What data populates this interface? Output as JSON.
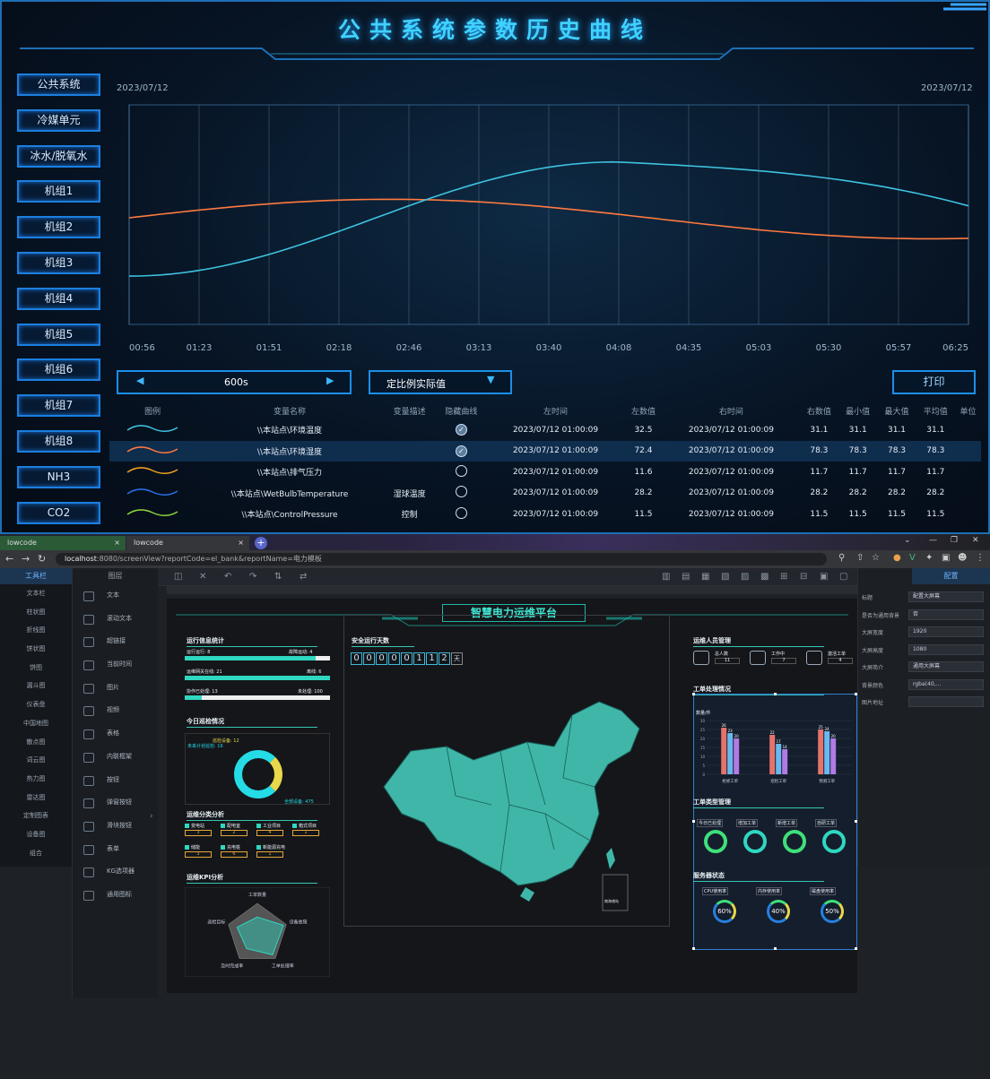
{
  "top": {
    "title": "公共系统参数历史曲线",
    "date_left": "2023/07/12",
    "date_right": "2023/07/12",
    "side_buttons": [
      "公共系统",
      "冷媒单元",
      "冰水/脱氧水",
      "机组1",
      "机组2",
      "机组3",
      "机组4",
      "机组5",
      "机组6",
      "机组7",
      "机组8",
      "NH3",
      "CO2"
    ],
    "time_ticks": [
      "00:56",
      "01:23",
      "01:51",
      "02:18",
      "02:46",
      "03:13",
      "03:40",
      "04:08",
      "04:35",
      "05:03",
      "05:30",
      "05:57",
      "06:25"
    ],
    "interval": "600s",
    "scale_mode": "定比例实际值",
    "print": "打印",
    "columns": [
      "图例",
      "变量名称",
      "变量描述",
      "隐藏曲线",
      "左时间",
      "左数值",
      "右时间",
      "右数值",
      "最小值",
      "最大值",
      "平均值",
      "单位"
    ],
    "rows": [
      {
        "color": "#3ec3e0",
        "name": "\\\\本站点\\环境温度",
        "desc": "",
        "hidden": true,
        "lt": "2023/07/12 01:00:09",
        "lv": "32.5",
        "rt": "2023/07/12 01:00:09",
        "rv": "31.1",
        "min": "31.1",
        "max": "31.1",
        "avg": "31.1",
        "unit": ""
      },
      {
        "color": "#ff7a40",
        "name": "\\\\本站点\\环境湿度",
        "desc": "",
        "hidden": true,
        "lt": "2023/07/12 01:00:09",
        "lv": "72.4",
        "rt": "2023/07/12 01:00:09",
        "rv": "78.3",
        "min": "78.3",
        "max": "78.3",
        "avg": "78.3",
        "unit": ""
      },
      {
        "color": "#f0a020",
        "name": "\\\\本站点\\排气压力",
        "desc": "",
        "hidden": false,
        "lt": "2023/07/12 01:00:09",
        "lv": "11.6",
        "rt": "2023/07/12 01:00:09",
        "rv": "11.7",
        "min": "11.7",
        "max": "11.7",
        "avg": "11.7",
        "unit": ""
      },
      {
        "color": "#2a6fe8",
        "name": "\\\\本站点\\WetBulbTemperature",
        "desc": "湿球温度",
        "hidden": false,
        "lt": "2023/07/12 01:00:09",
        "lv": "28.2",
        "rt": "2023/07/12 01:00:09",
        "rv": "28.2",
        "min": "28.2",
        "max": "28.2",
        "avg": "28.2",
        "unit": ""
      },
      {
        "color": "#8ad23a",
        "name": "\\\\本站点\\ControlPressure",
        "desc": "控制",
        "hidden": false,
        "lt": "2023/07/12 01:00:09",
        "lv": "11.5",
        "rt": "2023/07/12 01:00:09",
        "rv": "11.5",
        "min": "11.5",
        "max": "11.5",
        "avg": "11.5",
        "unit": ""
      }
    ],
    "curve_colors": {
      "teal": "#3ec3e0",
      "orange": "#ff7a40"
    }
  },
  "browser": {
    "tab1": "lowcode",
    "tab2": "lowcode",
    "url_host": "localhost",
    "url_rest": ":8080/screenView?reportCode=el_bank&reportName=电力模板"
  },
  "app": {
    "left_head": "工具栏",
    "left_items": [
      "文本栏",
      "柱状图",
      "折线图",
      "饼状图",
      "饼图",
      "漏斗图",
      "仪表盘",
      "中国地图",
      "散点图",
      "词云图",
      "热力图",
      "雷达图",
      "定制图表",
      "设备图",
      "组合"
    ],
    "comp_head": "图层",
    "comp_items": [
      "文本",
      "滚动文本",
      "超链接",
      "当前时间",
      "图片",
      "视频",
      "表格",
      "内联框架",
      "按钮",
      "弹窗按钮",
      "滑块按钮",
      "表单",
      "KG选项器",
      "通用图标"
    ],
    "right_head": "配置",
    "props": [
      {
        "label": "标题",
        "value": "配置大屏幕"
      },
      {
        "label": "是否为通用背景",
        "value": "否"
      },
      {
        "label": "大屏宽度",
        "value": "1920"
      },
      {
        "label": "大屏高度",
        "value": "1080"
      },
      {
        "label": "大屏简介",
        "value": "通用大屏幕"
      },
      {
        "label": "背景颜色",
        "value": "rgba(40,..."
      },
      {
        "label": "图片地址",
        "value": ""
      }
    ]
  },
  "screen": {
    "title": "智慧电力运维平台",
    "sec1": "运行信息统计",
    "stat1": "运行运行: 8",
    "stat1r": "故障运动: 4",
    "stat2": "运维网关在线: 21",
    "stat2r": "离线: 6",
    "stat3": "协作已处理: 13",
    "stat3r": "未处理: 100",
    "safe_title": "安全运行天数",
    "safe_digits": [
      "0",
      "0",
      "0",
      "0",
      "0",
      "1",
      "1",
      "2"
    ],
    "safe_unit": "天",
    "sec2": "今日巡检情况",
    "donut_a": "巡检设备: 12",
    "donut_b": "未来计划巡检: 16",
    "donut_c": "全部设备: 475",
    "sec3": "运维分类分析",
    "cats": [
      "变电站",
      "配电室",
      "工业项目",
      "箱式项目",
      "储能",
      "充电桩",
      "新能源充电"
    ],
    "cat_vals": [
      "3",
      "2",
      "4",
      "1",
      "3",
      "6",
      "1"
    ],
    "sec4": "运维KPI分析",
    "radar": [
      "工单数量",
      "设备故障",
      "工单处理率",
      "及时完成率",
      "巡检目标"
    ],
    "staff_title": "运维人员管理",
    "staff": [
      {
        "label": "总人数",
        "v": "11"
      },
      {
        "label": "工作中",
        "v": "7"
      },
      {
        "label": "激活工单",
        "v": "4"
      }
    ],
    "work_title": "工单处理情况",
    "bar_unit": "数量/件",
    "bar_cats": [
      "抢修工单",
      "巡检工单",
      "预测工单"
    ],
    "bar_vals_a": [
      26,
      22,
      25
    ],
    "bar_vals_b": [
      23,
      17,
      24
    ],
    "bar_vals_c": [
      20,
      14,
      20
    ],
    "bar_colors": [
      "#e5736c",
      "#6ab8f0",
      "#b17ae5"
    ],
    "order_title": "工单类型管理",
    "order_items": [
      "今日已处理",
      "增加工单",
      "新增工单",
      "自研工单"
    ],
    "server_title": "服务器状态",
    "server_items": [
      "CPU使用率",
      "内存使用率",
      "磁盘使用率"
    ],
    "server_vals": [
      "60%",
      "40%",
      "50%"
    ],
    "map_legend": "南海诸岛"
  }
}
